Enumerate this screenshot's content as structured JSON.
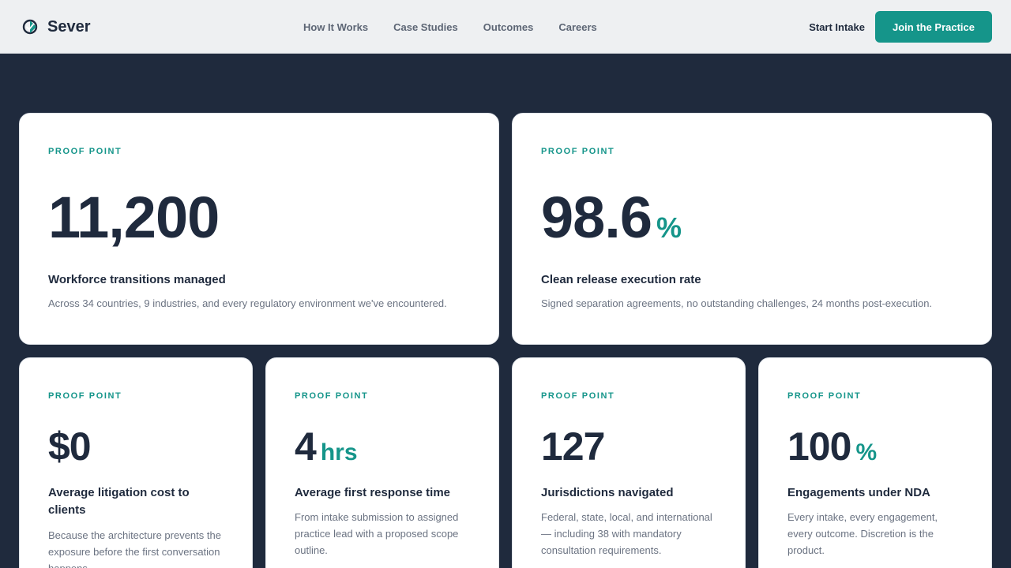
{
  "brand": {
    "name": "Sever",
    "logo_icon": "shield-compass-icon"
  },
  "nav": {
    "links": [
      "How It Works",
      "Case Studies",
      "Outcomes",
      "Careers"
    ]
  },
  "header_actions": {
    "start_intake": "Start Intake",
    "join_button": "Join the Practice"
  },
  "colors": {
    "accent": "#15958a",
    "navy": "#1f2a3d",
    "header_bg": "#eef0f2",
    "card_bg": "#ffffff",
    "muted_text": "#6b7382"
  },
  "proof_points": [
    {
      "eyebrow": "PROOF POINT",
      "value": "11,200",
      "unit": "",
      "title": "Workforce transitions managed",
      "description": "Across 34 countries, 9 industries, and every regulatory environment we've encountered."
    },
    {
      "eyebrow": "PROOF POINT",
      "value": "98.6",
      "unit": "%",
      "title": "Clean release execution rate",
      "description": "Signed separation agreements, no outstanding challenges, 24 months post-execution."
    },
    {
      "eyebrow": "PROOF POINT",
      "value": "$0",
      "unit": "",
      "title": "Average litigation cost to clients",
      "description": "Because the architecture prevents the exposure before the first conversation happens."
    },
    {
      "eyebrow": "PROOF POINT",
      "value": "4",
      "unit": "hrs",
      "title": "Average first response time",
      "description": "From intake submission to assigned practice lead with a proposed scope outline."
    },
    {
      "eyebrow": "PROOF POINT",
      "value": "127",
      "unit": "",
      "title": "Jurisdictions navigated",
      "description": "Federal, state, local, and international — including 38 with mandatory consultation requirements."
    },
    {
      "eyebrow": "PROOF POINT",
      "value": "100",
      "unit": "%",
      "title": "Engagements under NDA",
      "description": "Every intake, every engagement, every outcome. Discretion is the product."
    }
  ]
}
